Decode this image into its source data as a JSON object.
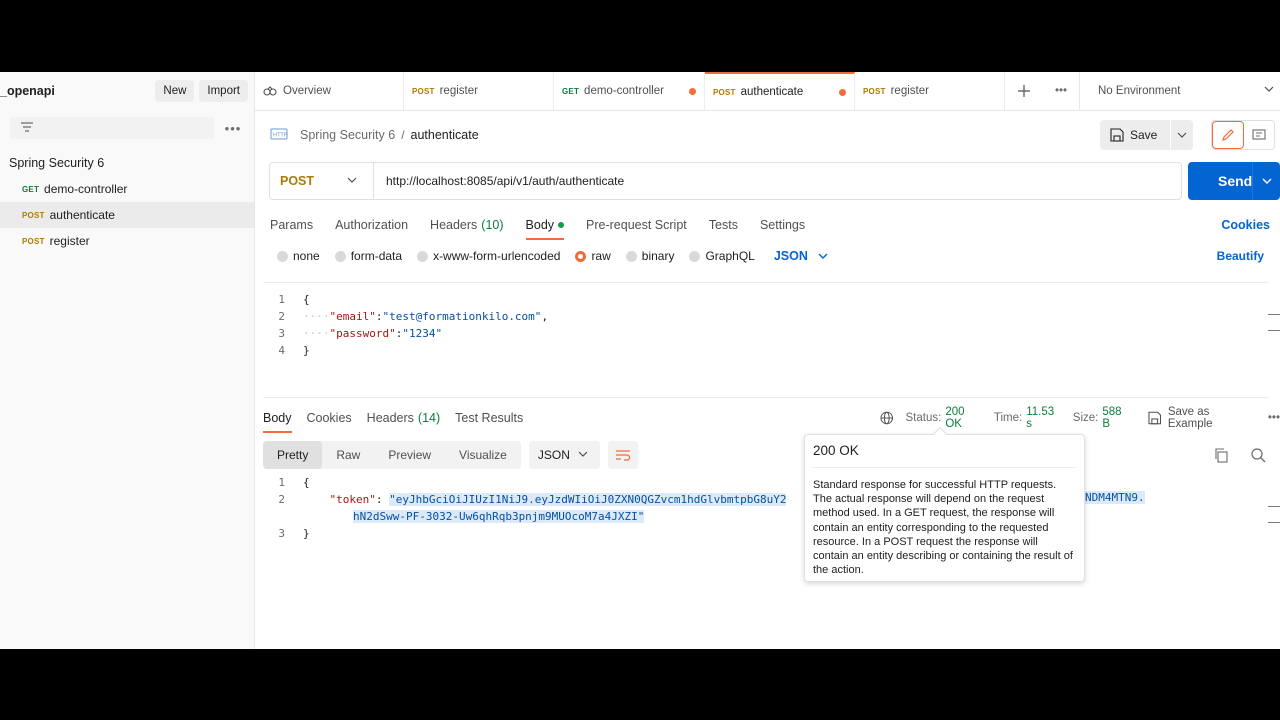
{
  "sidebar": {
    "workspace": "_openapi",
    "new_label": "New",
    "import_label": "Import",
    "collection": "Spring Security 6",
    "items": [
      {
        "method": "GET",
        "label": "demo-controller"
      },
      {
        "method": "POST",
        "label": "authenticate"
      },
      {
        "method": "POST",
        "label": "register"
      }
    ]
  },
  "tabs": [
    {
      "label": "Overview"
    },
    {
      "method": "POST",
      "label": "register"
    },
    {
      "method": "GET",
      "label": "demo-controller"
    },
    {
      "method": "POST",
      "label": "authenticate"
    },
    {
      "method": "POST",
      "label": "register"
    }
  ],
  "environment": "No Environment",
  "request": {
    "breadcrumb_parent": "Spring Security 6",
    "breadcrumb_sep": "/",
    "breadcrumb_current": "authenticate",
    "save_label": "Save",
    "method": "POST",
    "url": "http://localhost:8085/api/v1/auth/authenticate",
    "send_label": "Send",
    "tabs": [
      "Params",
      "Authorization",
      "Headers",
      "Body",
      "Pre-request Script",
      "Tests",
      "Settings"
    ],
    "headers_count": "(10)",
    "cookies_label": "Cookies",
    "body_types": [
      "none",
      "form-data",
      "x-www-form-urlencoded",
      "raw",
      "binary",
      "GraphQL"
    ],
    "body_lang": "JSON",
    "beautify_label": "Beautify",
    "body_lines": {
      "l1": "{",
      "email_key": "\"email\"",
      "email_val": "\"test@formationkilo.com\"",
      "password_key": "\"password\"",
      "password_val": "\"1234\"",
      "l4": "}"
    }
  },
  "response": {
    "tabs": [
      "Body",
      "Cookies",
      "Headers",
      "Test Results"
    ],
    "headers_count": "(14)",
    "status_label": "Status:",
    "status_value": "200 OK",
    "time_label": "Time:",
    "time_value": "11.53 s",
    "size_label": "Size:",
    "size_value": "588 B",
    "save_example_label": "Save as Example",
    "views": [
      "Pretty",
      "Raw",
      "Preview",
      "Visualize"
    ],
    "format": "JSON",
    "token_key": "\"token\"",
    "token_line1": "\"eyJhbGciOiJIUzI1NiJ9.eyJzdWIiOiJ0ZXN0QGZvcm1hdGlvbmtpbG8uY2",
    "token_line1_tail": "NDM4MTN9.",
    "token_line2": "hN2dSww-PF-3032-Uw6qhRqb3pnjm9MUOcoM7a4JXZI\""
  },
  "tooltip": {
    "title": "200 OK",
    "text": "Standard response for successful HTTP requests. The actual response will depend on the request method used. In a GET request, the response will contain an entity corresponding to the requested resource. In a POST request the response will contain an entity describing or containing the result of the action."
  },
  "colors": {
    "accent": "#f26b3a",
    "send": "#0265d2",
    "get": "#0c7e3a",
    "post": "#ad7a03"
  }
}
